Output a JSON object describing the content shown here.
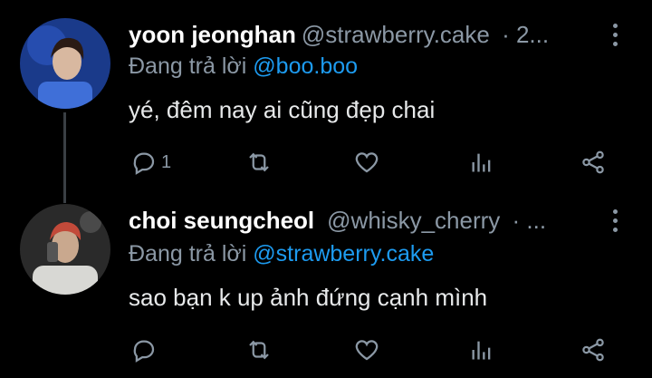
{
  "replying_prefix": "Đang trả lời",
  "tweets": [
    {
      "display_name": "yoon jeonghan",
      "handle": "@strawberry.cake",
      "meta": "· 2...",
      "reply_to": "@boo.boo",
      "text": "yé, đêm nay ai cũng đẹp chai",
      "reply_count": "1",
      "avatar_colors": {
        "bg": "#1a3a8a",
        "skin": "#d8b8a0",
        "hair": "#2a1a14"
      }
    },
    {
      "display_name": "choi seungcheol",
      "handle": "@whisky_cherry",
      "meta": "· ...",
      "reply_to": "@strawberry.cake",
      "text": "sao bạn k up ảnh đứng cạnh mình",
      "reply_count": "",
      "avatar_colors": {
        "bg": "#2a2a2a",
        "skin": "#c9a88e",
        "hair": "#c24a3a"
      }
    }
  ],
  "icons": [
    "reply-icon",
    "retweet-icon",
    "like-icon",
    "views-icon",
    "share-icon",
    "more-icon"
  ],
  "colors": {
    "background": "#000000",
    "text": "#e7e9ea",
    "muted": "#8b98a5",
    "link": "#1d9bf0"
  }
}
